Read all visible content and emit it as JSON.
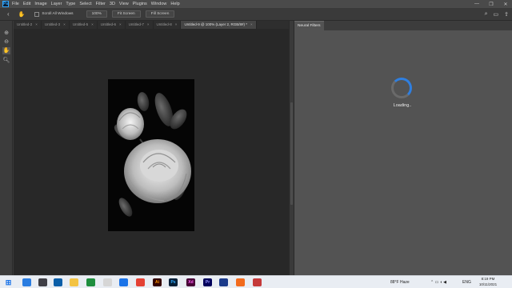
{
  "app": {
    "logo_text": "Ps",
    "menu": [
      "File",
      "Edit",
      "Image",
      "Layer",
      "Type",
      "Select",
      "Filter",
      "3D",
      "View",
      "Plugins",
      "Window",
      "Help"
    ],
    "window_controls": [
      "—",
      "❐",
      "✕"
    ]
  },
  "options_bar": {
    "scroll_all_windows": "Scroll All Windows",
    "zoom_value": "100%",
    "fit_screen": "Fit Screen",
    "fill_screen": "Fill Screen"
  },
  "tabs": [
    {
      "label": "Untitled-2",
      "active": false
    },
    {
      "label": "Untitled-3",
      "active": false
    },
    {
      "label": "Untitled-5",
      "active": false
    },
    {
      "label": "Untitled-6",
      "active": false
    },
    {
      "label": "Untitled-7",
      "active": false
    },
    {
      "label": "Untitled-8",
      "active": false
    },
    {
      "label": "Untitled-9 @ 100% (Layer 2, RGB/8#) *",
      "active": true
    }
  ],
  "panel": {
    "title": "Neural Filters",
    "loading_text": "Loading..",
    "spinner_color": "#2f7fe0"
  },
  "taskbar": {
    "weather": "88°F  Haze",
    "lang": "ENG",
    "time": "8:19 PM",
    "date": "10/11/2021"
  },
  "colors": {
    "workspace": "#282828",
    "panel": "#535353",
    "accent_blue": "#31a8ff"
  }
}
